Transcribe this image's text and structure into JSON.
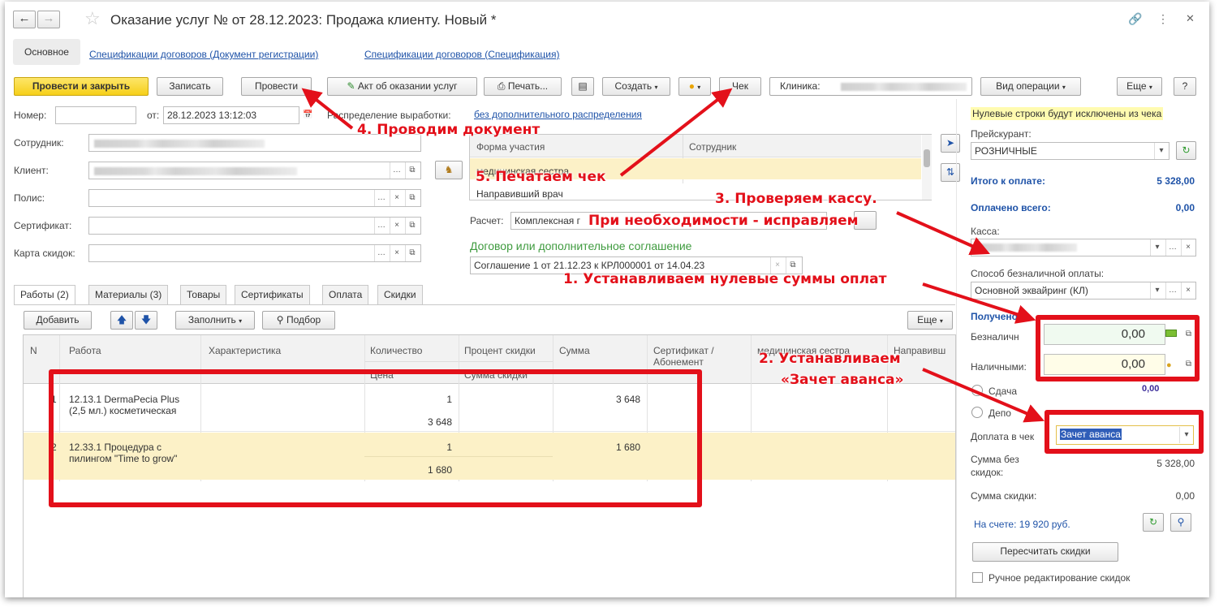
{
  "window": {
    "title": "Оказание услуг №  от 28.12.2023: Продажа клиенту.  Новый *",
    "link_icon": "link-icon",
    "menu_icon": "more-vertical-icon",
    "close_icon": "close-icon"
  },
  "nav_tabs": [
    "Основное",
    "Спецификации договоров (Документ регистрации)",
    "Спецификации договоров (Спецификация)"
  ],
  "toolbar": {
    "post_close": "Провести и закрыть",
    "save": "Записать",
    "post": "Провести",
    "act": "Акт об оказании услуг",
    "print": "Печать...",
    "create": "Создать",
    "receipt": "Чек",
    "clinic_label": "Клиника:",
    "operation": "Вид операции",
    "more": "Еще",
    "help": "?"
  },
  "form": {
    "number_label": "Номер:",
    "number_value": "",
    "date_label": "от:",
    "date_value": "28.12.2023 13:12:03",
    "distribution_label": "Распределение выработки:",
    "distribution_link": "без дополнительного распределения",
    "employee_label": "Сотрудник:",
    "client_label": "Клиент:",
    "policy_label": "Полис:",
    "certificate_label": "Сертификат:",
    "discount_card_label": "Карта скидок:",
    "participation": {
      "col_form": "Форма участия",
      "col_employee": "Сотрудник",
      "rows": [
        "медицинская сестра",
        "Направивший врач"
      ]
    },
    "calc_label": "Расчет:",
    "calc_value": "Комплексная г",
    "contract_heading": "Договор или дополнительное соглашение",
    "contract_value": "Соглашение 1 от 21.12.23 к КРЛ000001 от 14.04.23"
  },
  "tabs": [
    "Работы (2)",
    "Материалы (3)",
    "Товары",
    "Сертификаты",
    "Оплата",
    "Скидки"
  ],
  "table_toolbar": {
    "add": "Добавить",
    "fill": "Заполнить",
    "pick": "Подбор",
    "more": "Еще"
  },
  "table": {
    "headers": {
      "n": "N",
      "work": "Работа",
      "char": "Характеристика",
      "qty": "Количество",
      "price": "Цена",
      "discount_pct": "Процент скидки",
      "discount_sum": "Сумма скидки",
      "sum": "Сумма",
      "cert": "Сертификат / Абонемент",
      "nurse": "медицинская сестра",
      "referrer": "Направивш"
    },
    "rows": [
      {
        "n": "1",
        "work": "12.13.1 DermaPecia Plus (2,5 мл.) косметическая",
        "qty": "1",
        "price": "3 648",
        "sum": "3 648"
      },
      {
        "n": "2",
        "work": "12.33.1 Процедура с пилингом \"Time to grow\"",
        "qty": "1",
        "price": "1 680",
        "sum": "1 680"
      }
    ]
  },
  "right": {
    "notice": "Нулевые строки будут исключены из чека",
    "pricelist_label": "Прейскурант:",
    "pricelist_value": "РОЗНИЧНЫЕ",
    "total_label": "Итого к оплате:",
    "total_value": "5 328,00",
    "paid_label": "Оплачено всего:",
    "paid_value": "0,00",
    "cash_register_label": "Касса:",
    "noncash_method_label": "Способ безналичной оплаты:",
    "noncash_method_value": "Основной эквайринг (КЛ)",
    "received_label": "Получено",
    "noncash_label": "Безналичн",
    "noncash_value": "0,00",
    "cash_label": "Наличными:",
    "cash_value": "0,00",
    "change_label": "Сдача",
    "change_value": "0,00",
    "deposit_label": "Депо",
    "surcharge_label": "Доплата в чек",
    "surcharge_value": "Зачет аванса",
    "sum_wo_discount_label": "Сумма без скидок:",
    "sum_wo_discount_value": "5 328,00",
    "discount_sum_label": "Сумма скидки:",
    "discount_sum_value": "0,00",
    "account_balance": "На счете: 19 920 руб.",
    "recalc_button": "Пересчитать скидки",
    "manual_edit_label": "Ручное редактирование скидок"
  },
  "annotations": {
    "a1": "1. Устанавливаем нулевые суммы оплат",
    "a2_line1": "2. Устанавливаем",
    "a2_line2": "«Зачет аванса»",
    "a3_line1": "3. Проверяем кассу.",
    "a3_line2": "При необходимости - исправляем",
    "a4": "4. Проводим документ",
    "a5": "5. Печатаем чек"
  },
  "colors": {
    "annotation": "#e3101a",
    "primary_button": "#f6cf19",
    "link": "#1f53a8",
    "selected_row": "#fcf1c7",
    "notice_bg": "#fffbb0"
  }
}
